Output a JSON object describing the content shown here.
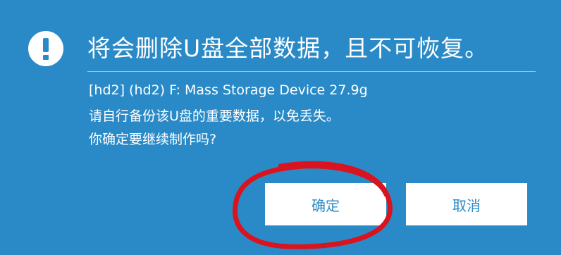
{
  "dialog": {
    "icon": "exclamation-icon",
    "title": "将会删除U盘全部数据，且不可恢复。",
    "lines": [
      "[hd2] (hd2) F: Mass Storage Device 27.9g",
      "请自行备份该U盘的重要数据，以免丢失。",
      "你确定要继续制作吗?"
    ],
    "buttons": {
      "ok_label": "确定",
      "cancel_label": "取消"
    }
  },
  "colors": {
    "background": "#2a8ac7",
    "text": "#ffffff",
    "button_text": "#2a8ac7",
    "annotation": "#d9141e"
  }
}
